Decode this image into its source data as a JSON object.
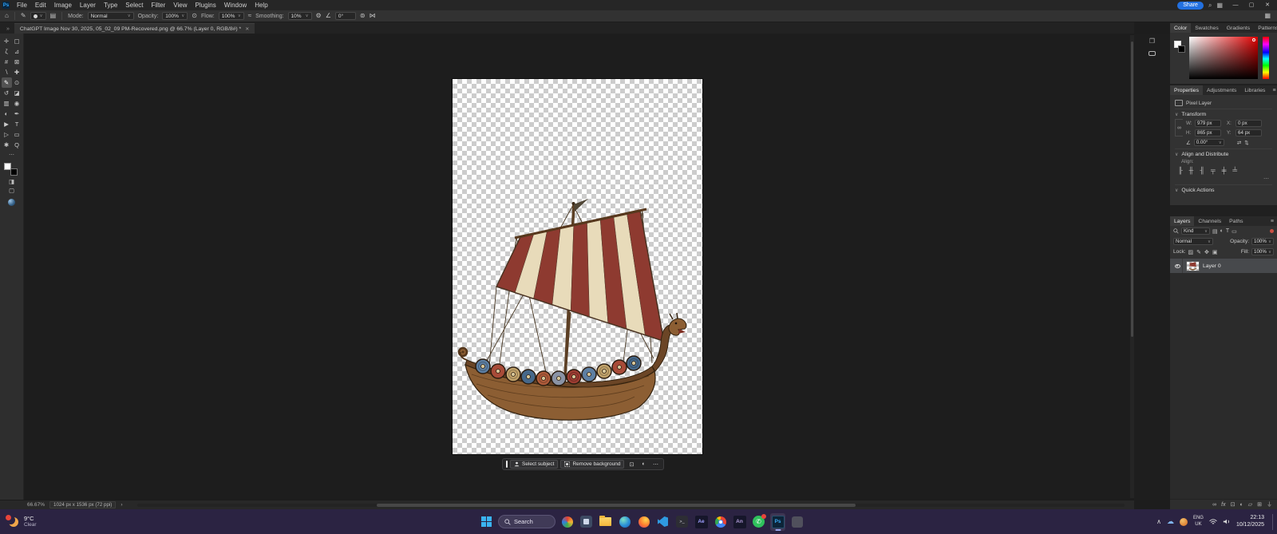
{
  "titlebar": {
    "logo_text": "Ps",
    "menus": [
      "File",
      "Edit",
      "Image",
      "Layer",
      "Type",
      "Select",
      "Filter",
      "View",
      "Plugins",
      "Window",
      "Help"
    ],
    "share_label": "Share",
    "window_controls": {
      "minimize": "—",
      "maximize": "▢",
      "close": "✕"
    }
  },
  "options_bar": {
    "mode_label": "Mode:",
    "mode_value": "Normal",
    "opacity_label": "Opacity:",
    "opacity_value": "100%",
    "flow_label": "Flow:",
    "flow_value": "100%",
    "smoothing_label": "Smoothing:",
    "smoothing_value": "10%",
    "angle_value": "0°"
  },
  "document_tab": {
    "title": "ChatGPT Image Nov 30, 2025, 05_02_09 PM-Recovered.png @ 66.7% (Layer 0, RGB/8#) *",
    "close_glyph": "✕"
  },
  "tools": {
    "items": [
      {
        "name": "move-tool",
        "glyph": "✛"
      },
      {
        "name": "marquee-tool",
        "glyph": "▢"
      },
      {
        "name": "lasso-tool",
        "glyph": "ζ"
      },
      {
        "name": "object-selection-tool",
        "glyph": "⊿"
      },
      {
        "name": "crop-tool",
        "glyph": "#"
      },
      {
        "name": "frame-tool",
        "glyph": "⊠"
      },
      {
        "name": "eyedropper-tool",
        "glyph": "∖"
      },
      {
        "name": "healing-brush-tool",
        "glyph": "✚"
      },
      {
        "name": "brush-tool",
        "glyph": "✎"
      },
      {
        "name": "clone-stamp-tool",
        "glyph": "⊙"
      },
      {
        "name": "history-brush-tool",
        "glyph": "↺"
      },
      {
        "name": "eraser-tool",
        "glyph": "◪"
      },
      {
        "name": "gradient-tool",
        "glyph": "▥"
      },
      {
        "name": "blur-tool",
        "glyph": "◉"
      },
      {
        "name": "dodge-tool",
        "glyph": "◐"
      },
      {
        "name": "pen-tool",
        "glyph": "✒"
      },
      {
        "name": "path-selection-tool",
        "glyph": "▶"
      },
      {
        "name": "type-tool",
        "glyph": "T"
      },
      {
        "name": "direct-selection-tool",
        "glyph": "▷"
      },
      {
        "name": "rectangle-tool",
        "glyph": "▭"
      },
      {
        "name": "hand-tool",
        "glyph": "✱"
      },
      {
        "name": "zoom-tool",
        "glyph": "Q"
      }
    ],
    "more_glyph": "⋯"
  },
  "color_panel": {
    "tabs": [
      "Color",
      "Swatches",
      "Gradients",
      "Patterns"
    ]
  },
  "properties_panel": {
    "tabs": [
      "Properties",
      "Adjustments",
      "Libraries"
    ],
    "layer_type": "Pixel Layer",
    "transform_title": "Transform",
    "w_label": "W:",
    "w_value": "979 px",
    "h_label": "H:",
    "h_value": "865 px",
    "x_label": "X:",
    "x_value": "0 px",
    "y_label": "Y:",
    "y_value": "64 px",
    "angle_value": "0.00°",
    "align_title": "Align and Distribute",
    "align_label": "Align:",
    "quick_actions_title": "Quick Actions"
  },
  "layers_panel": {
    "tabs": [
      "Layers",
      "Channels",
      "Paths"
    ],
    "filter_value": "Kind",
    "blend_mode": "Normal",
    "opacity_label": "Opacity:",
    "opacity_value": "100%",
    "lock_label": "Lock:",
    "fill_label": "Fill:",
    "fill_value": "100%",
    "layer_name": "Layer 0"
  },
  "contextual_bar": {
    "select_subject_label": "Select subject",
    "remove_background_label": "Remove background",
    "more_glyph": "⋯"
  },
  "status_bar": {
    "zoom_value": "66.67%",
    "doc_info": "1024 px x 1536 px (72 ppi)",
    "chevron": "›"
  },
  "taskbar": {
    "weather_temp": "9°C",
    "weather_condition": "Clear",
    "search_label": "Search",
    "terminal_glyph": ">_",
    "adobe_ae": "Ae",
    "adobe_an": "An",
    "photoshop": "Ps",
    "whatsapp_glyph": "✆",
    "lang_line1": "ENG",
    "lang_line2": "UK",
    "time": "22:13",
    "date": "10/12/2025"
  },
  "icons": {
    "home": "⌂",
    "brush": "✎",
    "dropdown": "∨",
    "panel_toggle": "▤",
    "pressure": "⊙",
    "airbrush": "≈",
    "gear": "⚙",
    "angle": "∠",
    "pressure_size": "⊚",
    "symmetry": "⋈",
    "workspace": "▦",
    "search_glyph": "⌕",
    "collapse": "»",
    "panel": "❐",
    "menu": "≡",
    "link": "∞",
    "flip_h": "⇄",
    "flip_v": "⇅",
    "align_1": "╟",
    "align_2": "╫",
    "align_3": "╢",
    "align_4": "╤",
    "align_5": "╪",
    "align_6": "╧",
    "filter_px": "▤",
    "filter_adj": "◐",
    "filter_type": "T",
    "filter_shape": "▭",
    "filter_smart": "▣",
    "lock_checker": "▨",
    "lock_brush": "✎",
    "lock_move": "✥",
    "lock_all": "▣",
    "fx": "fx",
    "mask": "⊡",
    "adjust": "◐",
    "group": "▱",
    "new_layer": "⊞",
    "trash": "⏚",
    "quick_mask": "◨",
    "screen_mode": "▢",
    "ctx_crop": "⊡",
    "ctx_adjust": "◐",
    "tray_chevron": "∧",
    "cloud": "☁"
  },
  "artwork": {
    "description": "Viking longship illustration with red and cream striped square sail, rigging, shield-lined wooden hull and dragon figurehead on a transparent checkerboard canvas",
    "colors": {
      "sail_red": "#8E3A30",
      "sail_cream": "#E8DBBA",
      "hull_brown": "#8C5E33",
      "hull_dark": "#6B4526",
      "outline": "#33220F"
    }
  }
}
